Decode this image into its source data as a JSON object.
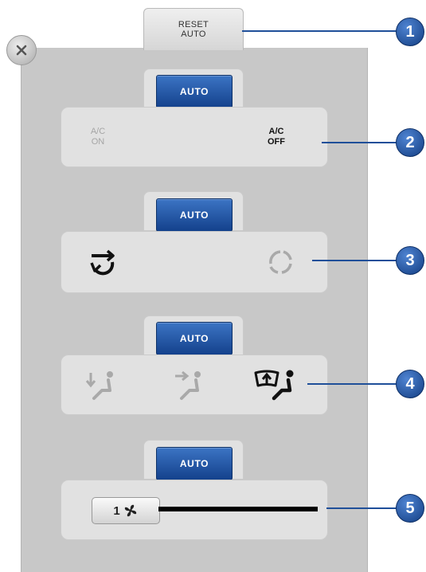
{
  "reset_tab": {
    "line1": "RESET",
    "line2": "AUTO"
  },
  "close_icon": "close-x-icon",
  "groups": [
    {
      "auto_label": "AUTO",
      "options": [
        {
          "line1": "A/C",
          "line2": "ON",
          "active": false
        },
        {
          "line1": "A/C",
          "line2": "OFF",
          "active": true
        }
      ]
    },
    {
      "auto_label": "AUTO",
      "options": [
        {
          "icon": "recirculation-icon",
          "active": true
        },
        {
          "icon": "fresh-air-icon",
          "active": false
        }
      ]
    },
    {
      "auto_label": "AUTO",
      "options": [
        {
          "icon": "floor-vent-icon",
          "active": false
        },
        {
          "icon": "face-vent-icon",
          "active": false
        },
        {
          "icon": "defrost-vent-icon",
          "active": true
        }
      ]
    },
    {
      "auto_label": "AUTO",
      "fan": {
        "speed": "1",
        "icon": "fan-icon",
        "level_fraction": 0.0
      }
    }
  ],
  "callouts": [
    "1",
    "2",
    "3",
    "4",
    "5"
  ],
  "colors": {
    "auto_button": "#1d4f9e",
    "panel": "#c8c8c8",
    "group_box": "#e1e1e1",
    "callout": "#1f4f99"
  }
}
